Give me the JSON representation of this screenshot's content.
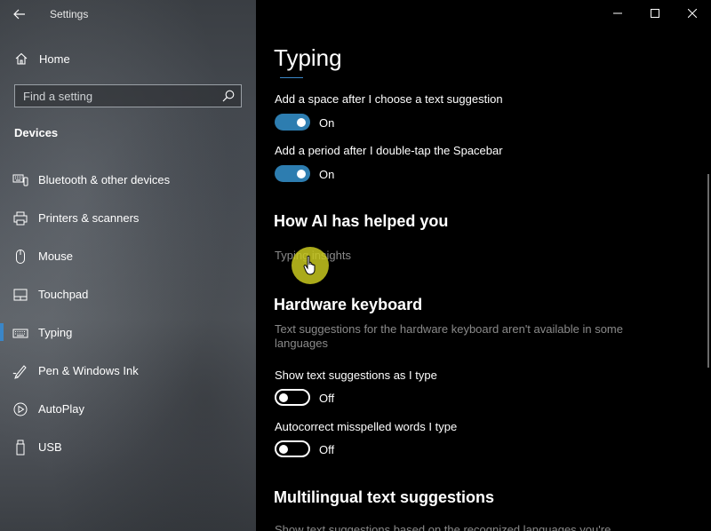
{
  "app": {
    "title": "Settings"
  },
  "sidebar": {
    "home_label": "Home",
    "search_placeholder": "Find a setting",
    "section": "Devices",
    "items": [
      {
        "label": "Bluetooth & other devices",
        "icon": "bluetooth-devices-icon"
      },
      {
        "label": "Printers & scanners",
        "icon": "printer-icon"
      },
      {
        "label": "Mouse",
        "icon": "mouse-icon"
      },
      {
        "label": "Touchpad",
        "icon": "touchpad-icon"
      },
      {
        "label": "Typing",
        "icon": "keyboard-icon",
        "active": true
      },
      {
        "label": "Pen & Windows Ink",
        "icon": "pen-icon"
      },
      {
        "label": "AutoPlay",
        "icon": "autoplay-icon"
      },
      {
        "label": "USB",
        "icon": "usb-icon"
      }
    ]
  },
  "main": {
    "title": "Typing",
    "settings": [
      {
        "label": "Add a space after I choose a text suggestion",
        "state": "On"
      },
      {
        "label": "Add a period after I double-tap the Spacebar",
        "state": "On"
      }
    ],
    "ai_heading": "How AI has helped you",
    "ai_link": "Typing insights",
    "hw_heading": "Hardware keyboard",
    "hw_desc": "Text suggestions for the hardware keyboard aren't available in some languages",
    "hw_settings": [
      {
        "label": "Show text suggestions as I type",
        "state": "Off"
      },
      {
        "label": "Autocorrect misspelled words I type",
        "state": "Off"
      }
    ],
    "ml_heading": "Multilingual text suggestions",
    "ml_desc_partial": "Show text suggestions based on the recognized languages you're"
  },
  "colors": {
    "accent": "#3a86c8",
    "toggle_on": "#2d7db0",
    "muted_text": "#8a8a8a"
  }
}
